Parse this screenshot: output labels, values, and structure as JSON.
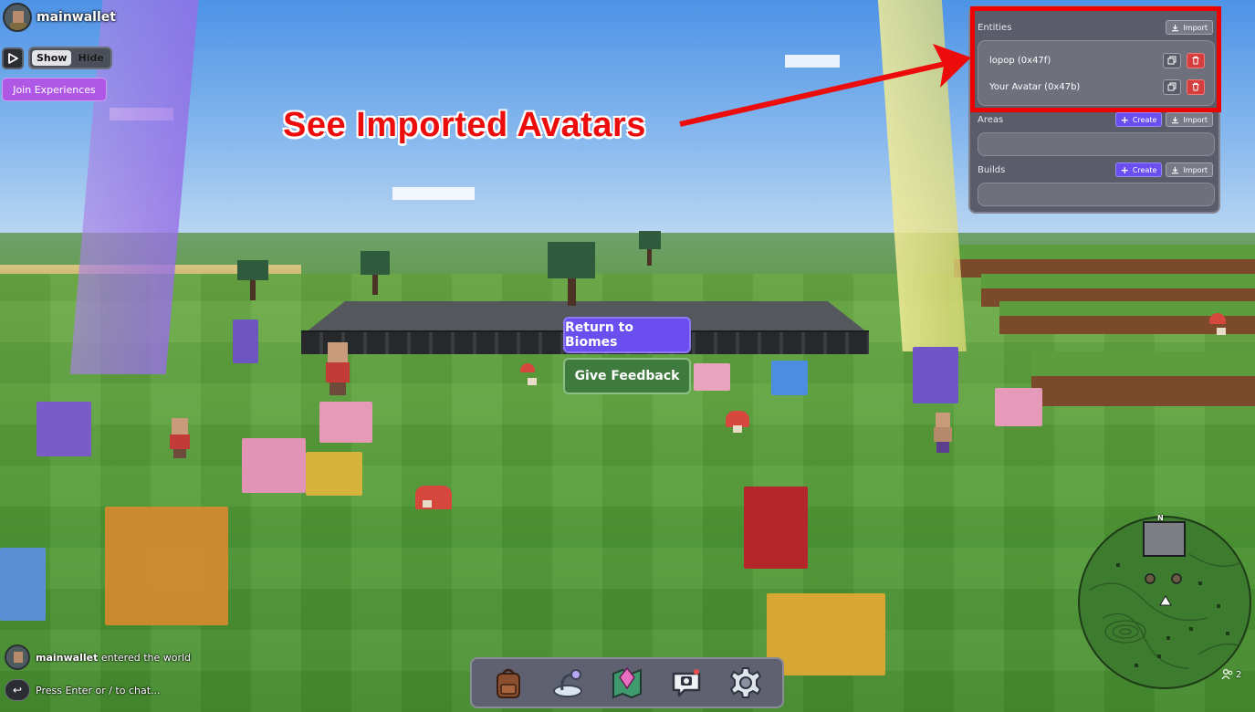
{
  "player": {
    "username": "mainwallet"
  },
  "hud": {
    "show_label": "Show",
    "hide_label": "Hide",
    "join_label": "Join Experiences"
  },
  "center_menu": {
    "return_label": "Return to Biomes",
    "feedback_label": "Give Feedback"
  },
  "panel": {
    "entities": {
      "title": "Entities",
      "import_label": "Import",
      "items": [
        {
          "name": "lopop (0x47f)"
        },
        {
          "name": "Your Avatar (0x47b)"
        }
      ]
    },
    "areas": {
      "title": "Areas",
      "create_label": "Create",
      "import_label": "Import"
    },
    "builds": {
      "title": "Builds",
      "create_label": "Create",
      "import_label": "Import"
    }
  },
  "annotation": {
    "text": "See Imported Avatars",
    "color": "#ec0c0c"
  },
  "chat": {
    "log": [
      {
        "name": "mainwallet",
        "message": "entered the world"
      }
    ],
    "prompt": "Press Enter or / to chat..."
  },
  "toolbar": {
    "items": [
      "backpack-icon",
      "pet-icon",
      "map-icon",
      "camera-icon",
      "settings-icon"
    ]
  },
  "minimap": {
    "north_label": "N",
    "player_count": "2"
  },
  "colors": {
    "primary": "#6a4ef0",
    "danger": "#d63d3d",
    "feedback": "#3f7a3e",
    "join": "#b058e6"
  }
}
